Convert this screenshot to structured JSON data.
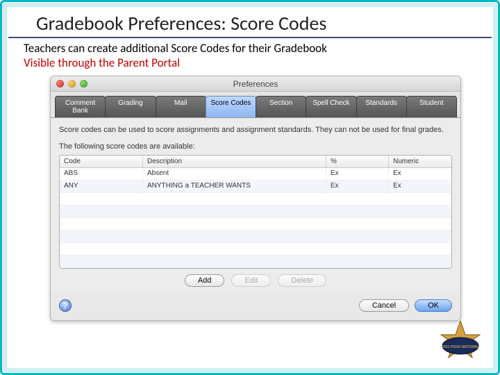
{
  "slide": {
    "title": "Gradebook Preferences:  Score Codes",
    "line1": "Teachers can create additional Score Codes for their Gradebook",
    "line2": "Visible through the Parent Portal"
  },
  "window": {
    "title": "Preferences",
    "tabs": [
      "Comment Bank",
      "Grading",
      "Mail",
      "Score Codes",
      "Section",
      "Spell Check",
      "Standards",
      "Student"
    ],
    "active_tab": 3,
    "desc": "Score codes can be used to score assignments and assignment standards. They can not be used for final grades.",
    "desc2": "The following score codes are available:",
    "columns": [
      "Code",
      "Description",
      "%",
      "Numeric"
    ],
    "rows": [
      {
        "code": "ABS",
        "description": "Absent",
        "pct": "Ex",
        "numeric": "Ex"
      },
      {
        "code": "ANY",
        "description": "ANYTHING a TEACHER WANTS",
        "pct": "Ex",
        "numeric": "Ex"
      }
    ],
    "buttons": {
      "add": "Add",
      "edit": "Edit",
      "delete": "Delete",
      "cancel": "Cancel",
      "ok": "OK"
    },
    "help_glyph": "?"
  },
  "logo_text": "2011 PSUG NATIONAL"
}
